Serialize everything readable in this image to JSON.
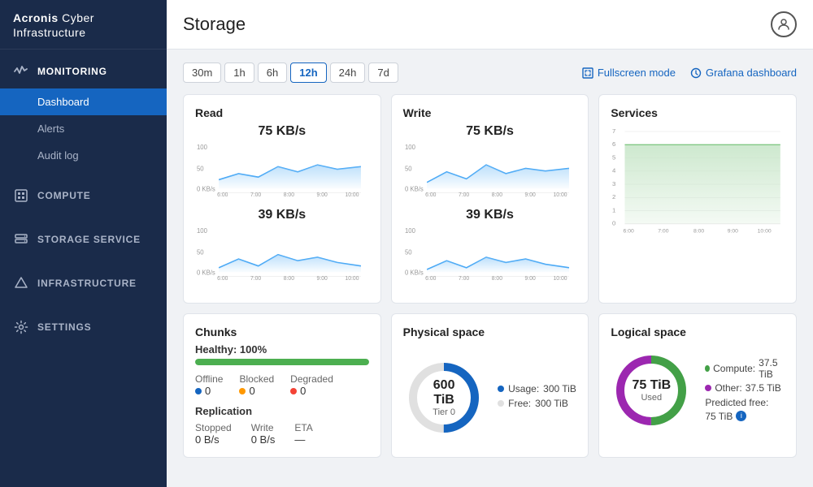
{
  "logo": {
    "brand": "Acronis",
    "product": "Cyber Infrastructure"
  },
  "sidebar": {
    "monitoring_label": "MONITORING",
    "monitoring_items": [
      {
        "label": "Dashboard",
        "active": true
      },
      {
        "label": "Alerts",
        "active": false
      },
      {
        "label": "Audit log",
        "active": false
      }
    ],
    "compute_label": "COMPUTE",
    "storage_label": "STORAGE SERVICE",
    "infrastructure_label": "INFRASTRUCTURE",
    "settings_label": "SETTINGS"
  },
  "header": {
    "title": "Storage"
  },
  "time_range": {
    "options": [
      "30m",
      "1h",
      "6h",
      "12h",
      "24h",
      "7d"
    ],
    "active": "12h",
    "fullscreen": "Fullscreen mode",
    "grafana": "Grafana dashboard"
  },
  "read_card": {
    "title": "Read",
    "top_value": "75 KB/s",
    "bottom_value": "39 KB/s",
    "y_labels": [
      "100",
      "50",
      "0 KB/s"
    ],
    "x_labels": [
      "6:00",
      "7:00",
      "8:00",
      "9:00",
      "10:00"
    ]
  },
  "write_card": {
    "title": "Write",
    "top_value": "75 KB/s",
    "bottom_value": "39 KB/s",
    "y_labels": [
      "100",
      "50",
      "0 KB/s"
    ],
    "x_labels": [
      "6:00",
      "7:00",
      "8:00",
      "9:00",
      "10:00"
    ]
  },
  "services_card": {
    "title": "Services",
    "y_max": 7,
    "y_labels": [
      "7",
      "6",
      "5",
      "4",
      "3",
      "2",
      "1",
      "0"
    ],
    "x_labels": [
      "6:00",
      "7:00",
      "8:00",
      "9:00",
      "10:00"
    ]
  },
  "chunks_card": {
    "title": "Chunks",
    "healthy_label": "Healthy:",
    "healthy_value": "100%",
    "progress_pct": 100,
    "offline_label": "Offline",
    "offline_value": "0",
    "blocked_label": "Blocked",
    "blocked_value": "0",
    "degraded_label": "Degraded",
    "degraded_value": "0",
    "replication_title": "Replication",
    "stopped_label": "Stopped",
    "stopped_value": "0 B/s",
    "write_label": "Write",
    "write_value": "0 B/s",
    "eta_label": "ETA",
    "eta_value": "—"
  },
  "physical_card": {
    "title": "Physical space",
    "total": "600 TiB",
    "tier": "Tier 0",
    "usage_label": "Usage:",
    "usage_value": "300 TiB",
    "free_label": "Free:",
    "free_value": "300 TiB"
  },
  "logical_card": {
    "title": "Logical space",
    "used": "75 TiB",
    "used_label": "Used",
    "compute_label": "Compute:",
    "compute_value": "37.5 TiB",
    "other_label": "Other:",
    "other_value": "37.5 TiB",
    "predicted_label": "Predicted free:",
    "predicted_value": "75 TiB"
  }
}
